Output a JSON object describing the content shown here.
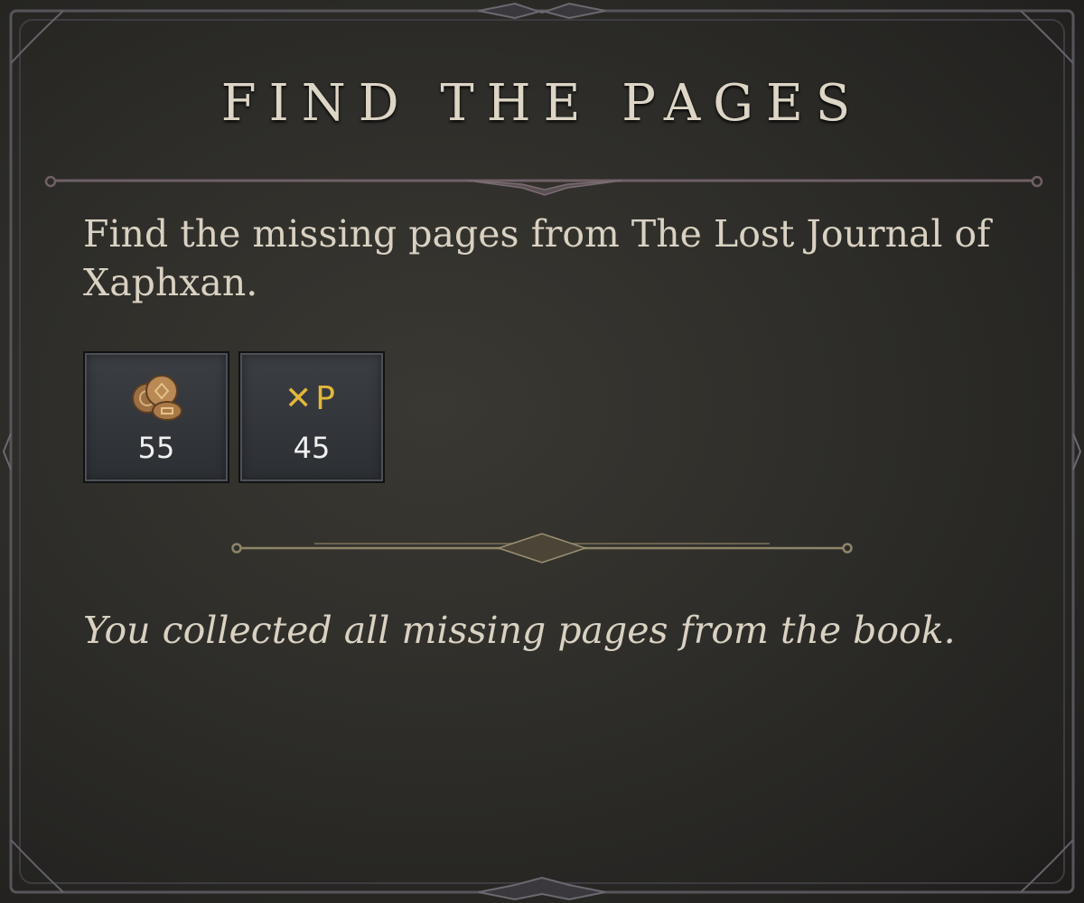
{
  "quest": {
    "title": "FIND THE PAGES",
    "description": "Find the missing pages from The Lost Journal of Xaphxan.",
    "completion_text": "You collected all missing pages from the book."
  },
  "rewards": [
    {
      "icon": "gold-coins-icon",
      "value": "55"
    },
    {
      "icon": "xp-icon",
      "icon_text": "✕P",
      "value": "45"
    }
  ],
  "colors": {
    "title_text": "#ddd5c6",
    "body_text": "#d9d1c2",
    "xp_accent": "#e2b73a",
    "coin": "#b98a55",
    "divider_gold": "#8e8468",
    "divider_mauve": "#6f6066"
  }
}
